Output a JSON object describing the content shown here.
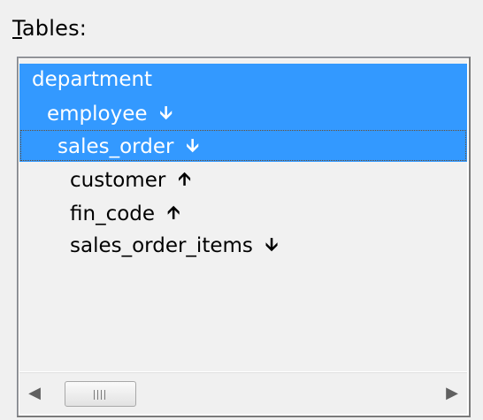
{
  "label": {
    "first_letter": "T",
    "rest": "ables:"
  },
  "tree": {
    "items": [
      {
        "label": "department",
        "level": 0,
        "selected": true,
        "arrow": ""
      },
      {
        "label": "employee",
        "level": 1,
        "selected": true,
        "arrow": "🡫"
      },
      {
        "label": "sales_order",
        "level": 2,
        "selected": true,
        "focused": true,
        "arrow": "🡫"
      },
      {
        "label": "customer",
        "level": 3,
        "selected": false,
        "arrow": "🡩"
      },
      {
        "label": "fin_code",
        "level": 3,
        "selected": false,
        "arrow": "🡩"
      },
      {
        "label": "sales_order_items",
        "level": 3,
        "selected": false,
        "arrow": "🡫"
      }
    ]
  },
  "scrollbar": {
    "left_arrow": "◀",
    "right_arrow": "▶",
    "left_icon": "chevron-left-icon",
    "right_icon": "chevron-right-icon"
  },
  "colors": {
    "selection": "#3399ff",
    "selection_text": "#ffffff",
    "panel_bg": "#f1f1f1",
    "window_bg": "#f0f0f0"
  }
}
